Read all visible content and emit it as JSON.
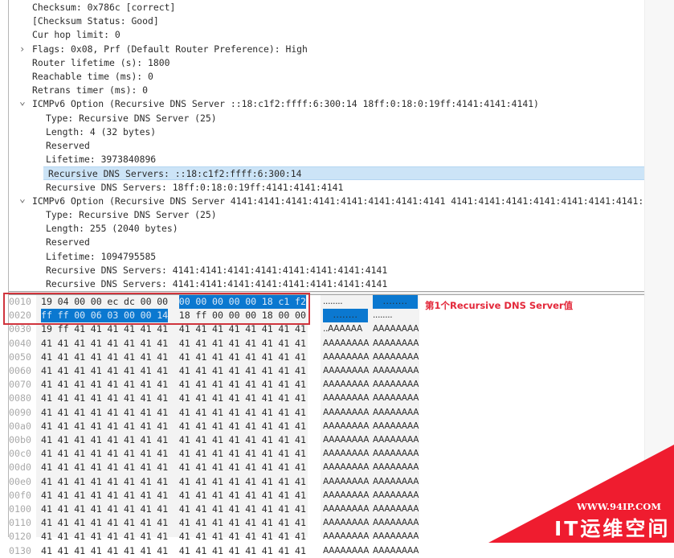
{
  "tree": {
    "rows": [
      {
        "text": "Checksum: 0x786c [correct]",
        "indent": 1,
        "caret": ""
      },
      {
        "text": "[Checksum Status: Good]",
        "indent": 1,
        "caret": ""
      },
      {
        "text": "Cur hop limit: 0",
        "indent": 1,
        "caret": ""
      },
      {
        "text": "Flags: 0x08, Prf (Default Router Preference): High",
        "indent": 1,
        "caret": "collapsed"
      },
      {
        "text": "Router lifetime (s): 1800",
        "indent": 1,
        "caret": ""
      },
      {
        "text": "Reachable time (ms): 0",
        "indent": 1,
        "caret": ""
      },
      {
        "text": "Retrans timer (ms): 0",
        "indent": 1,
        "caret": ""
      },
      {
        "text": "ICMPv6 Option (Recursive DNS Server ::18:c1f2:ffff:6:300:14 18ff:0:18:0:19ff:4141:4141:4141)",
        "indent": 1,
        "caret": "expanded"
      },
      {
        "text": "Type: Recursive DNS Server (25)",
        "indent": 2,
        "caret": ""
      },
      {
        "text": "Length: 4 (32 bytes)",
        "indent": 2,
        "caret": ""
      },
      {
        "text": "Reserved",
        "indent": 2,
        "caret": ""
      },
      {
        "text": "Lifetime: 3973840896",
        "indent": 2,
        "caret": ""
      },
      {
        "text": "Recursive DNS Servers: ::18:c1f2:ffff:6:300:14",
        "indent": 2,
        "caret": "",
        "selected": true
      },
      {
        "text": "Recursive DNS Servers: 18ff:0:18:0:19ff:4141:4141:4141",
        "indent": 2,
        "caret": ""
      },
      {
        "text": "ICMPv6 Option (Recursive DNS Server 4141:4141:4141:4141:4141:4141:4141:4141 4141:4141:4141:4141:4141:4141:4141:",
        "indent": 1,
        "caret": "expanded"
      },
      {
        "text": "Type: Recursive DNS Server (25)",
        "indent": 2,
        "caret": ""
      },
      {
        "text": "Length: 255 (2040 bytes)",
        "indent": 2,
        "caret": ""
      },
      {
        "text": "Reserved",
        "indent": 2,
        "caret": ""
      },
      {
        "text": "Lifetime: 1094795585",
        "indent": 2,
        "caret": ""
      },
      {
        "text": "Recursive DNS Servers: 4141:4141:4141:4141:4141:4141:4141:4141",
        "indent": 2,
        "caret": ""
      },
      {
        "text": "Recursive DNS Servers: 4141:4141:4141:4141:4141:4141:4141:4141",
        "indent": 2,
        "caret": ""
      }
    ]
  },
  "hex": {
    "rows": [
      {
        "offset": "0010",
        "bytes": [
          "19",
          "04",
          "00",
          "00",
          "ec",
          "dc",
          "00",
          "00",
          "00",
          "00",
          "00",
          "00",
          "00",
          "18",
          "c1",
          "f2"
        ],
        "ascii": [
          "........",
          "........"
        ],
        "hl_bytes": [
          8,
          9,
          10,
          11,
          12,
          13,
          14,
          15
        ],
        "hl_ascii": [
          1
        ]
      },
      {
        "offset": "0020",
        "bytes": [
          "ff",
          "ff",
          "00",
          "06",
          "03",
          "00",
          "00",
          "14",
          "18",
          "ff",
          "00",
          "00",
          "00",
          "18",
          "00",
          "00"
        ],
        "ascii": [
          "........",
          "........"
        ],
        "hl_bytes": [
          0,
          1,
          2,
          3,
          4,
          5,
          6,
          7
        ],
        "hl_ascii": [
          0
        ]
      },
      {
        "offset": "0030",
        "bytes": [
          "19",
          "ff",
          "41",
          "41",
          "41",
          "41",
          "41",
          "41",
          "41",
          "41",
          "41",
          "41",
          "41",
          "41",
          "41",
          "41"
        ],
        "ascii": [
          "..AAAAAA",
          "AAAAAAAA"
        ]
      },
      {
        "offset": "0040",
        "bytes": [
          "41",
          "41",
          "41",
          "41",
          "41",
          "41",
          "41",
          "41",
          "41",
          "41",
          "41",
          "41",
          "41",
          "41",
          "41",
          "41"
        ],
        "ascii": [
          "AAAAAAAA",
          "AAAAAAAA"
        ]
      },
      {
        "offset": "0050",
        "bytes": [
          "41",
          "41",
          "41",
          "41",
          "41",
          "41",
          "41",
          "41",
          "41",
          "41",
          "41",
          "41",
          "41",
          "41",
          "41",
          "41"
        ],
        "ascii": [
          "AAAAAAAA",
          "AAAAAAAA"
        ]
      },
      {
        "offset": "0060",
        "bytes": [
          "41",
          "41",
          "41",
          "41",
          "41",
          "41",
          "41",
          "41",
          "41",
          "41",
          "41",
          "41",
          "41",
          "41",
          "41",
          "41"
        ],
        "ascii": [
          "AAAAAAAA",
          "AAAAAAAA"
        ]
      },
      {
        "offset": "0070",
        "bytes": [
          "41",
          "41",
          "41",
          "41",
          "41",
          "41",
          "41",
          "41",
          "41",
          "41",
          "41",
          "41",
          "41",
          "41",
          "41",
          "41"
        ],
        "ascii": [
          "AAAAAAAA",
          "AAAAAAAA"
        ]
      },
      {
        "offset": "0080",
        "bytes": [
          "41",
          "41",
          "41",
          "41",
          "41",
          "41",
          "41",
          "41",
          "41",
          "41",
          "41",
          "41",
          "41",
          "41",
          "41",
          "41"
        ],
        "ascii": [
          "AAAAAAAA",
          "AAAAAAAA"
        ]
      },
      {
        "offset": "0090",
        "bytes": [
          "41",
          "41",
          "41",
          "41",
          "41",
          "41",
          "41",
          "41",
          "41",
          "41",
          "41",
          "41",
          "41",
          "41",
          "41",
          "41"
        ],
        "ascii": [
          "AAAAAAAA",
          "AAAAAAAA"
        ]
      },
      {
        "offset": "00a0",
        "bytes": [
          "41",
          "41",
          "41",
          "41",
          "41",
          "41",
          "41",
          "41",
          "41",
          "41",
          "41",
          "41",
          "41",
          "41",
          "41",
          "41"
        ],
        "ascii": [
          "AAAAAAAA",
          "AAAAAAAA"
        ]
      },
      {
        "offset": "00b0",
        "bytes": [
          "41",
          "41",
          "41",
          "41",
          "41",
          "41",
          "41",
          "41",
          "41",
          "41",
          "41",
          "41",
          "41",
          "41",
          "41",
          "41"
        ],
        "ascii": [
          "AAAAAAAA",
          "AAAAAAAA"
        ]
      },
      {
        "offset": "00c0",
        "bytes": [
          "41",
          "41",
          "41",
          "41",
          "41",
          "41",
          "41",
          "41",
          "41",
          "41",
          "41",
          "41",
          "41",
          "41",
          "41",
          "41"
        ],
        "ascii": [
          "AAAAAAAA",
          "AAAAAAAA"
        ]
      },
      {
        "offset": "00d0",
        "bytes": [
          "41",
          "41",
          "41",
          "41",
          "41",
          "41",
          "41",
          "41",
          "41",
          "41",
          "41",
          "41",
          "41",
          "41",
          "41",
          "41"
        ],
        "ascii": [
          "AAAAAAAA",
          "AAAAAAAA"
        ]
      },
      {
        "offset": "00e0",
        "bytes": [
          "41",
          "41",
          "41",
          "41",
          "41",
          "41",
          "41",
          "41",
          "41",
          "41",
          "41",
          "41",
          "41",
          "41",
          "41",
          "41"
        ],
        "ascii": [
          "AAAAAAAA",
          "AAAAAAAA"
        ]
      },
      {
        "offset": "00f0",
        "bytes": [
          "41",
          "41",
          "41",
          "41",
          "41",
          "41",
          "41",
          "41",
          "41",
          "41",
          "41",
          "41",
          "41",
          "41",
          "41",
          "41"
        ],
        "ascii": [
          "AAAAAAAA",
          "AAAAAAAA"
        ]
      },
      {
        "offset": "0100",
        "bytes": [
          "41",
          "41",
          "41",
          "41",
          "41",
          "41",
          "41",
          "41",
          "41",
          "41",
          "41",
          "41",
          "41",
          "41",
          "41",
          "41"
        ],
        "ascii": [
          "AAAAAAAA",
          "AAAAAAAA"
        ]
      },
      {
        "offset": "0110",
        "bytes": [
          "41",
          "41",
          "41",
          "41",
          "41",
          "41",
          "41",
          "41",
          "41",
          "41",
          "41",
          "41",
          "41",
          "41",
          "41",
          "41"
        ],
        "ascii": [
          "AAAAAAAA",
          "AAAAAAAA"
        ]
      },
      {
        "offset": "0120",
        "bytes": [
          "41",
          "41",
          "41",
          "41",
          "41",
          "41",
          "41",
          "41",
          "41",
          "41",
          "41",
          "41",
          "41",
          "41",
          "41",
          "41"
        ],
        "ascii": [
          "AAAAAAAA",
          "AAAAAAAA"
        ]
      },
      {
        "offset": "0130",
        "bytes": [
          "41",
          "41",
          "41",
          "41",
          "41",
          "41",
          "41",
          "41",
          "41",
          "41",
          "41",
          "41",
          "41",
          "41",
          "41",
          "41"
        ],
        "ascii": [
          "AAAAAAAA",
          "AAAAAAAA"
        ]
      }
    ]
  },
  "annotation": {
    "text": "第1个Recursive DNS Server值",
    "color": "#e3283a"
  },
  "watermark": {
    "url": "WWW.94IP.COM",
    "name": "IT运维空间",
    "color": "#ef1c2f"
  }
}
